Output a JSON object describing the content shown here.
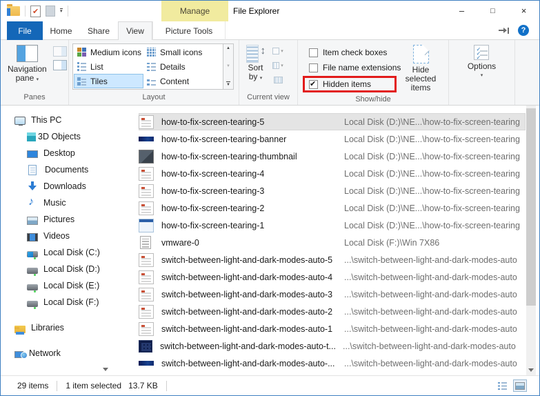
{
  "window": {
    "title": "File Explorer"
  },
  "tabs": {
    "file": "File",
    "home": "Home",
    "share": "Share",
    "view": "View",
    "active": "View",
    "contextual_group": "Manage",
    "picture_tools": "Picture Tools"
  },
  "icons": {
    "minimize": "–",
    "maximize": "□",
    "close": "×",
    "help": "?",
    "dropdown": "▾",
    "scroll_up": "▲",
    "scroll_down": "▼",
    "more": "▼"
  },
  "ribbon": {
    "panes_label": "Panes",
    "navigation_pane_line1": "Navigation",
    "navigation_pane_line2": "pane",
    "layout_label": "Layout",
    "layout_items": [
      {
        "label": "Medium icons",
        "icon": "medium"
      },
      {
        "label": "List",
        "icon": "list"
      },
      {
        "label": "Tiles",
        "icon": "tiles",
        "selected": true
      },
      {
        "label": "Small icons",
        "icon": "small"
      },
      {
        "label": "Details",
        "icon": "details"
      },
      {
        "label": "Content",
        "icon": "content"
      }
    ],
    "current_view_label": "Current view",
    "sort_by_line1": "Sort",
    "sort_by_line2": "by",
    "show_hide_label": "Show/hide",
    "checkboxes": [
      {
        "label": "Item check boxes",
        "checked": false
      },
      {
        "label": "File name extensions",
        "checked": false
      },
      {
        "label": "Hidden items",
        "checked": true,
        "highlighted": true
      }
    ],
    "hide_selected_line1": "Hide selected",
    "hide_selected_line2": "items",
    "options_label": "Options"
  },
  "sidebar": {
    "items": [
      {
        "label": "This PC",
        "icon": "pc",
        "level": "0"
      },
      {
        "label": "3D Objects",
        "icon": "cube",
        "level": "1"
      },
      {
        "label": "Desktop",
        "icon": "desktop",
        "level": "1"
      },
      {
        "label": "Documents",
        "icon": "doc",
        "level": "1"
      },
      {
        "label": "Downloads",
        "icon": "down",
        "level": "1"
      },
      {
        "label": "Music",
        "icon": "music",
        "level": "1"
      },
      {
        "label": "Pictures",
        "icon": "pics",
        "level": "1"
      },
      {
        "label": "Videos",
        "icon": "videos",
        "level": "1"
      },
      {
        "label": "Local Disk (C:)",
        "icon": "diskwin",
        "level": "1"
      },
      {
        "label": "Local Disk (D:)",
        "icon": "disk",
        "level": "1"
      },
      {
        "label": "Local Disk  (E:)",
        "icon": "disk",
        "level": "1"
      },
      {
        "label": "Local Disk (F:)",
        "icon": "disk",
        "level": "1"
      },
      {
        "label": "Libraries",
        "icon": "lib",
        "level": "0",
        "gap": true
      },
      {
        "label": "Network",
        "icon": "network",
        "level": "0",
        "gap": true
      }
    ]
  },
  "files": {
    "rows": [
      {
        "name": "how-to-fix-screen-tearing-5",
        "location": "Local Disk (D:)\\NE...\\how-to-fix-screen-tearing",
        "icon": "page",
        "selected": true
      },
      {
        "name": "how-to-fix-screen-tearing-banner",
        "location": "Local Disk (D:)\\NE...\\how-to-fix-screen-tearing",
        "icon": "banner"
      },
      {
        "name": "how-to-fix-screen-tearing-thumbnail",
        "location": "Local Disk (D:)\\NE...\\how-to-fix-screen-tearing",
        "icon": "photo"
      },
      {
        "name": "how-to-fix-screen-tearing-4",
        "location": "Local Disk (D:)\\NE...\\how-to-fix-screen-tearing",
        "icon": "page"
      },
      {
        "name": "how-to-fix-screen-tearing-3",
        "location": "Local Disk (D:)\\NE...\\how-to-fix-screen-tearing",
        "icon": "page"
      },
      {
        "name": "how-to-fix-screen-tearing-2",
        "location": "Local Disk (D:)\\NE...\\how-to-fix-screen-tearing",
        "icon": "page"
      },
      {
        "name": "how-to-fix-screen-tearing-1",
        "location": "Local Disk (D:)\\NE...\\how-to-fix-screen-tearing",
        "icon": "window"
      },
      {
        "name": "vmware-0",
        "location": "Local Disk (F:)\\Win 7X86",
        "icon": "textdoc"
      },
      {
        "name": "switch-between-light-and-dark-modes-auto-5",
        "location": "...\\switch-between-light-and-dark-modes-auto",
        "icon": "page"
      },
      {
        "name": "switch-between-light-and-dark-modes-auto-4",
        "location": "...\\switch-between-light-and-dark-modes-auto",
        "icon": "page"
      },
      {
        "name": "switch-between-light-and-dark-modes-auto-3",
        "location": "...\\switch-between-light-and-dark-modes-auto",
        "icon": "page"
      },
      {
        "name": "switch-between-light-and-dark-modes-auto-2",
        "location": "...\\switch-between-light-and-dark-modes-auto",
        "icon": "page"
      },
      {
        "name": "switch-between-light-and-dark-modes-auto-1",
        "location": "...\\switch-between-light-and-dark-modes-auto",
        "icon": "page"
      },
      {
        "name": "switch-between-light-and-dark-modes-auto-t...",
        "location": "...\\switch-between-light-and-dark-modes-auto",
        "icon": "thumbdark"
      },
      {
        "name": "switch-between-light-and-dark-modes-auto-...",
        "location": "...\\switch-between-light-and-dark-modes-auto",
        "icon": "banner"
      }
    ]
  },
  "status_bar": {
    "total": "29 items",
    "selection_count": "1 item selected",
    "selection_size": "13.7 KB"
  },
  "colors": {
    "accent_blue": "#1467b8",
    "contextual_yellow": "#f1eb9f",
    "highlight_red": "#e21b1b",
    "tile_selected": "#cde8ff"
  }
}
